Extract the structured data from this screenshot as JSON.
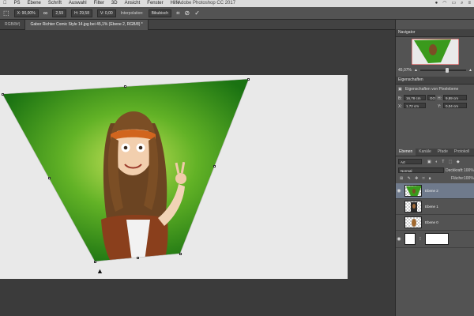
{
  "menubar": {
    "items": [
      "PS",
      "Ebene",
      "Schrift",
      "Auswahl",
      "Filter",
      "3D",
      "Ansicht",
      "Fenster",
      "Hilfe"
    ],
    "window_title": "Adobe Photoshop CC 2017"
  },
  "options_bar": {
    "x_value": "X: 90,00%",
    "w_value": "2,59",
    "h_value": "H: 29,58",
    "v_value": "V: 0,00",
    "interp_label": "Interpolation:",
    "interp_value": "Bikubisch"
  },
  "doc_tabs": [
    {
      "label": "RGB/8#)",
      "active": false
    },
    {
      "label": "Gabor Richter Comic Style 14.jpg bei 45,1% (Ebene 2, RGB/8) *",
      "active": true
    }
  ],
  "navigator": {
    "title": "Navigator",
    "zoom": "45,07%"
  },
  "properties": {
    "title": "Eigenschaften",
    "subtitle": "Eigenschaften von Pixelebene",
    "w_label": "B:",
    "w_value": "16,78 cm",
    "link": "GO",
    "h_label": "H:",
    "h_value": "9,89 cm",
    "x_label": "X:",
    "x_value": "1,72 cm",
    "y_label": "Y:",
    "y_value": "0,04 cm"
  },
  "layers": {
    "tabs": [
      {
        "label": "Ebenen",
        "active": true
      },
      {
        "label": "Kanäle",
        "active": false
      },
      {
        "label": "Pfade",
        "active": false
      },
      {
        "label": "Protokoll",
        "active": false
      }
    ],
    "search_placeholder": "Art",
    "blend_mode": "Normal",
    "opacity_label": "Deckkraft:",
    "opacity_value": "100%",
    "fill_label": "Fläche:",
    "fill_value": "100%",
    "rows": [
      {
        "name": "Ebene 2",
        "selected": true
      },
      {
        "name": "Ebene 1",
        "selected": false
      },
      {
        "name": "Ebene 0",
        "selected": false
      }
    ]
  },
  "colors": {
    "panel_bg": "#535353",
    "canvas_bg": "#3b3b3b",
    "selection": "#6f7a8c",
    "green_dark": "#1e7d14",
    "green_light": "#b3d94a"
  }
}
